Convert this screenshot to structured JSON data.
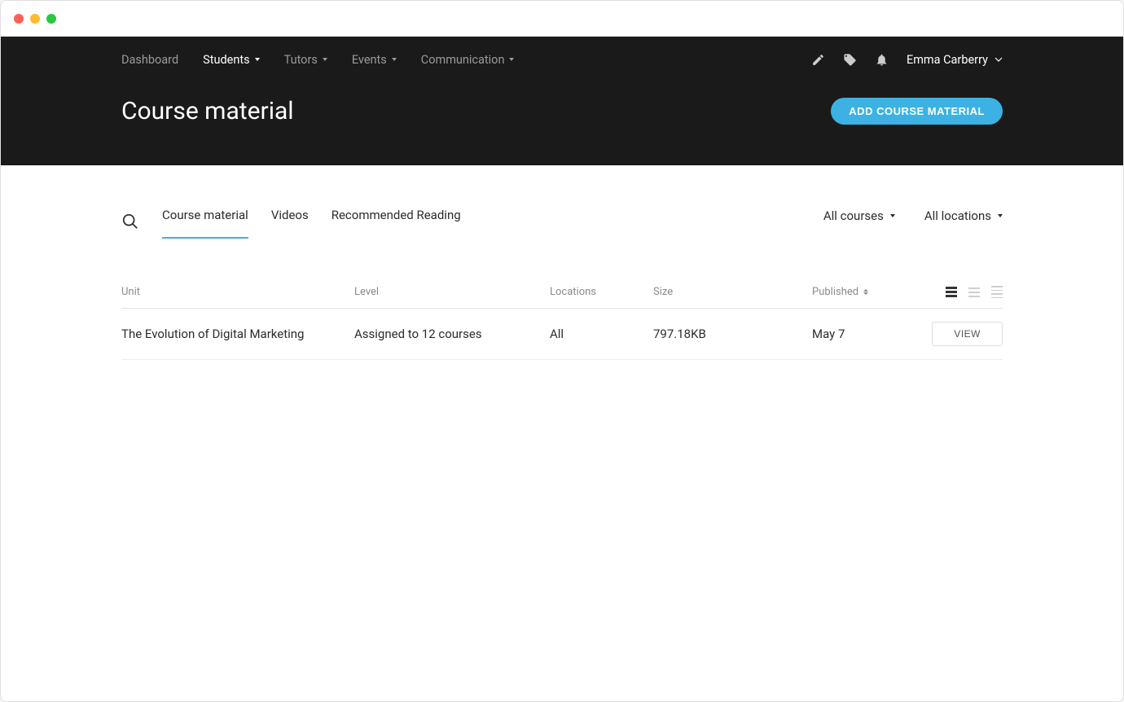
{
  "nav": {
    "items": [
      {
        "label": "Dashboard",
        "hasDropdown": false,
        "active": false
      },
      {
        "label": "Students",
        "hasDropdown": true,
        "active": true
      },
      {
        "label": "Tutors",
        "hasDropdown": true,
        "active": false
      },
      {
        "label": "Events",
        "hasDropdown": true,
        "active": false
      },
      {
        "label": "Communication",
        "hasDropdown": true,
        "active": false
      }
    ],
    "user": "Emma Carberry"
  },
  "page": {
    "title": "Course material",
    "add_button": "ADD COURSE MATERIAL"
  },
  "tabs": [
    {
      "label": "Course material",
      "active": true
    },
    {
      "label": "Videos",
      "active": false
    },
    {
      "label": "Recommended Reading",
      "active": false
    }
  ],
  "filters": {
    "course": "All courses",
    "location": "All locations"
  },
  "table": {
    "headers": {
      "unit": "Unit",
      "level": "Level",
      "locations": "Locations",
      "size": "Size",
      "published": "Published"
    },
    "rows": [
      {
        "unit": "The Evolution of Digital Marketing",
        "level": "Assigned to 12 courses",
        "locations": "All",
        "size": "797.18KB",
        "published": "May 7",
        "action": "VIEW"
      }
    ]
  }
}
